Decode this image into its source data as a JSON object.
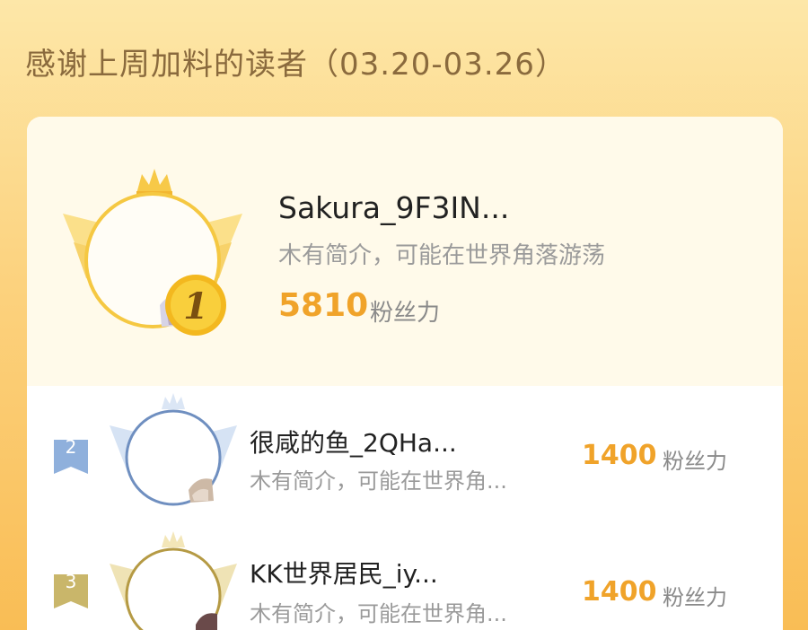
{
  "header": {
    "title": "感谢上周加料的读者（03.20-03.26）"
  },
  "leaderboard": {
    "top": {
      "rank": "1",
      "name": "Sakura_9F3IN...",
      "bio": "木有简介，可能在世界角落游荡",
      "fans": "5810",
      "fans_unit": "粉丝力",
      "icons": [
        "crown-icon",
        "wing-icon",
        "medal-icon"
      ]
    },
    "items": [
      {
        "rank": "2",
        "name": "很咸的鱼_2QHa...",
        "bio": "木有简介，可能在世界角...",
        "fans": "1400",
        "fans_unit": "粉丝力"
      },
      {
        "rank": "3",
        "name": "KK世界居民_iy...",
        "bio": "木有简介，可能在世界角...",
        "fans": "1400",
        "fans_unit": "粉丝力"
      }
    ]
  },
  "colors": {
    "background_top": "#fde7a8",
    "background_bottom": "#f9bd55",
    "gold": "#f5c33b",
    "silver_blue": "#8fb0dc",
    "bronze": "#c9b66a",
    "fans_value": "#f0a32a"
  }
}
